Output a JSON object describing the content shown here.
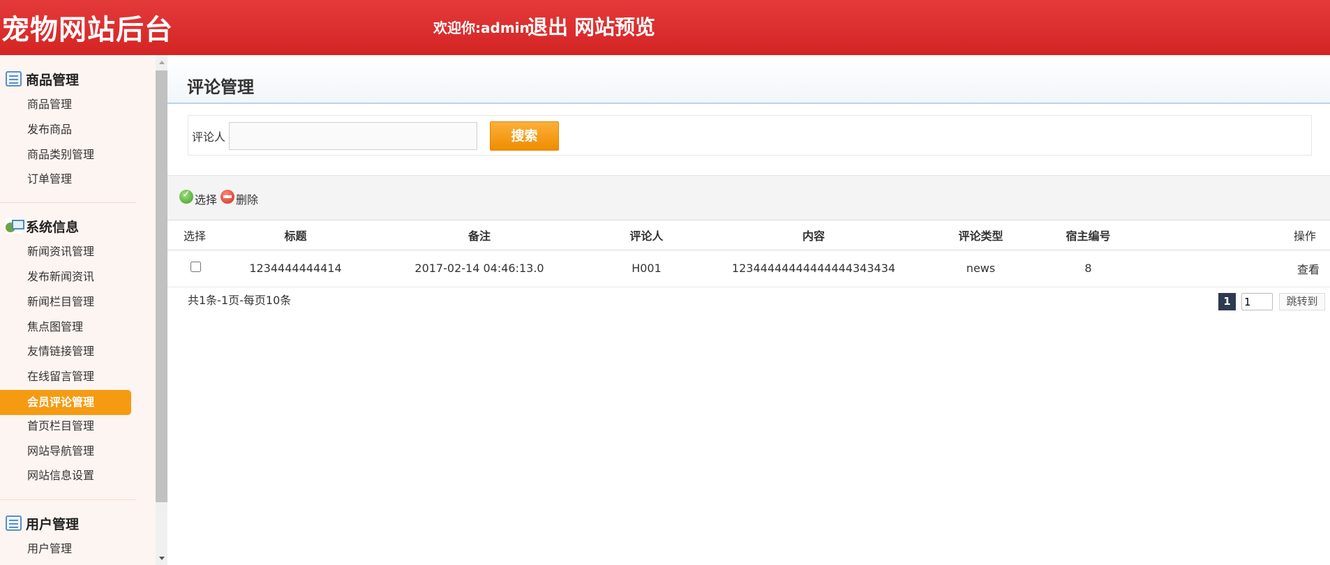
{
  "header": {
    "site_title": "宠物网站后台",
    "welcome_prefix": "欢迎你:",
    "username": "admin",
    "logout": "退出",
    "preview": "网站预览"
  },
  "sidebar": {
    "groups": [
      {
        "title": "商品管理",
        "icon": "document-list-icon",
        "items": [
          "商品管理",
          "发布商品",
          "商品类别管理",
          "订单管理"
        ]
      },
      {
        "title": "系统信息",
        "icon": "system-info-icon",
        "items": [
          "新闻资讯管理",
          "发布新闻资讯",
          "新闻栏目管理",
          "焦点图管理",
          "友情链接管理",
          "在线留言管理",
          "会员评论管理",
          "首页栏目管理",
          "网站导航管理",
          "网站信息设置"
        ]
      },
      {
        "title": "用户管理",
        "icon": "document-list-icon",
        "items": [
          "用户管理"
        ]
      }
    ],
    "active_item": "会员评论管理"
  },
  "main": {
    "title": "评论管理",
    "search": {
      "label": "评论人",
      "value": "",
      "button": "搜索"
    },
    "toolbar": {
      "select": "选择",
      "delete": "删除"
    },
    "table": {
      "columns": [
        "选择",
        "标题",
        "备注",
        "评论人",
        "内容",
        "评论类型",
        "宿主编号",
        "操作"
      ],
      "rows": [
        {
          "title": "1234444444414",
          "remark": "2017-02-14 04:46:13.0",
          "commenter": "H001",
          "content": "12344444444444444343434",
          "type": "news",
          "host_id": "8",
          "action": "查看"
        }
      ]
    },
    "pager": {
      "summary": "共1条-1页-每页10条",
      "current_page": "1",
      "page_input": "1",
      "jump": "跳转到"
    }
  },
  "colors": {
    "header_red": "#d42424",
    "active_orange": "#f59b12",
    "search_button": "#f08c00",
    "page_num_bg": "#2e3a4f"
  }
}
